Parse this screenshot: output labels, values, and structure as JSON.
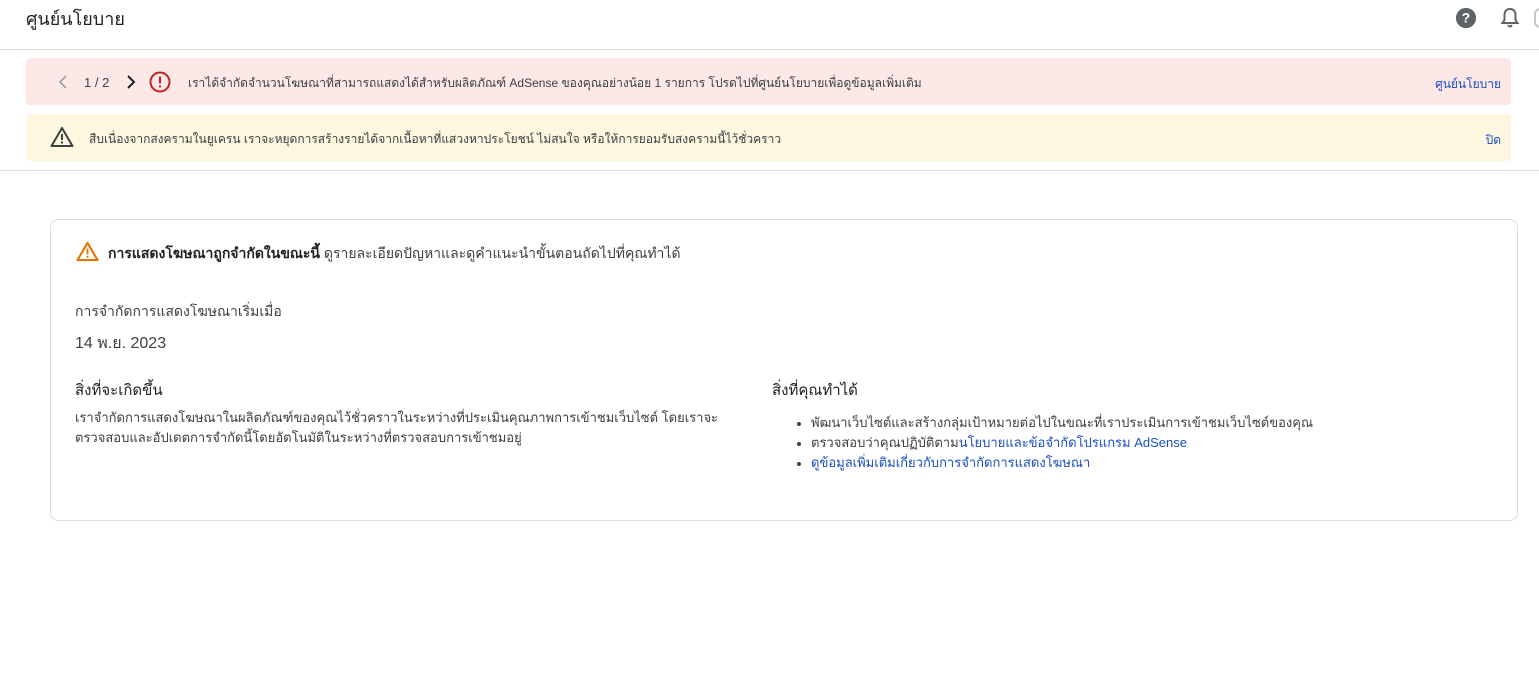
{
  "header": {
    "title": "ศูนย์นโยบาย",
    "help_icon": "help-icon",
    "bell_icon": "bell-icon"
  },
  "banners": {
    "error": {
      "pager": "1 / 2",
      "text": "เราได้จำกัดจำนวนโฆษณาที่สามารถแสดงได้สำหรับผลิตภัณฑ์ AdSense ของคุณอย่างน้อย 1 รายการ โปรดไปที่ศูนย์นโยบายเพื่อดูข้อมูลเพิ่มเติม",
      "action": "ศูนย์นโยบาย",
      "color": "#fce8e6"
    },
    "warning": {
      "text": "สืบเนื่องจากสงครามในยูเครน เราจะหยุดการสร้างรายได้จากเนื้อหาที่แสวงหาประโยชน์ ไม่สนใจ หรือให้การยอมรับสงครามนี้ไว้ชั่วคราว",
      "action": "ปิด",
      "color": "#fef7e0"
    }
  },
  "card": {
    "headline_bold": "การแสดงโฆษณาถูกจำกัดในขณะนี้",
    "headline_rest": " ดูรายละเอียดปัญหาและดูคำแนะนำขั้นตอนถัดไปที่คุณทำได้",
    "since_label": "การจำกัดการแสดงโฆษณาเริ่มเมื่อ",
    "since_date": "14 พ.ย. 2023",
    "what_happens": {
      "title": "สิ่งที่จะเกิดขึ้น",
      "body": "เราจำกัดการแสดงโฆษณาในผลิตภัณฑ์ของคุณไว้ชั่วคราวในระหว่างที่ประเมินคุณภาพการเข้าชมเว็บไซต์ โดยเราจะตรวจสอบและอัปเดตการจำกัดนี้โดยอัตโนมัติในระหว่างที่ตรวจสอบการเข้าชมอยู่"
    },
    "what_you_can_do": {
      "title": "สิ่งที่คุณทำได้",
      "item1": "พัฒนาเว็บไซต์และสร้างกลุ่มเป้าหมายต่อไปในขณะที่เราประเมินการเข้าชมเว็บไซต์ของคุณ",
      "item2_prefix": "ตรวจสอบว่าคุณปฏิบัติตาม",
      "item2_link": "นโยบายและข้อจำกัดโปรแกรม AdSense",
      "item3_link": "ดูข้อมูลเพิ่มเติมเกี่ยวกับการจำกัดการแสดงโฆษณา"
    }
  },
  "colors": {
    "link": "#1a4ec2",
    "error_icon": "#c5221f",
    "warning_icon_card": "#e37400"
  }
}
